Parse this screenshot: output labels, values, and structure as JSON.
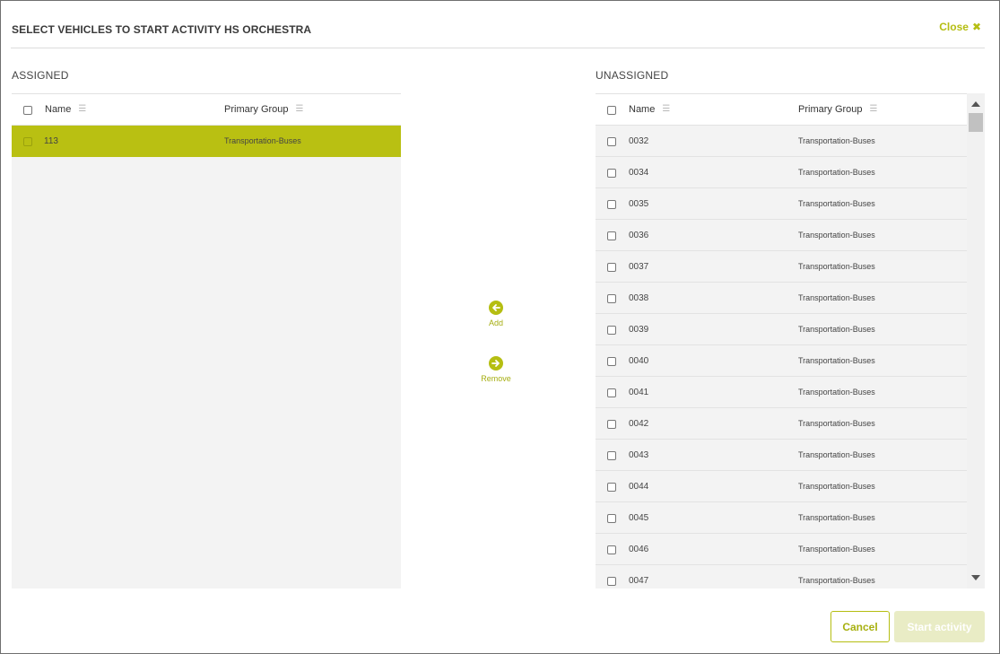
{
  "dialog": {
    "title": "SELECT VEHICLES TO START ACTIVITY HS ORCHESTRA",
    "close_label": "Close",
    "accent_color": "#b5be12"
  },
  "assigned": {
    "section_title": "ASSIGNED",
    "columns": {
      "name": "Name",
      "group": "Primary Group"
    },
    "rows": [
      {
        "name": "113",
        "group": "Transportation-Buses",
        "selected": true
      }
    ]
  },
  "unassigned": {
    "section_title": "UNASSIGNED",
    "columns": {
      "name": "Name",
      "group": "Primary Group"
    },
    "rows": [
      {
        "name": "0032",
        "group": "Transportation-Buses"
      },
      {
        "name": "0034",
        "group": "Transportation-Buses"
      },
      {
        "name": "0035",
        "group": "Transportation-Buses"
      },
      {
        "name": "0036",
        "group": "Transportation-Buses"
      },
      {
        "name": "0037",
        "group": "Transportation-Buses"
      },
      {
        "name": "0038",
        "group": "Transportation-Buses"
      },
      {
        "name": "0039",
        "group": "Transportation-Buses"
      },
      {
        "name": "0040",
        "group": "Transportation-Buses"
      },
      {
        "name": "0041",
        "group": "Transportation-Buses"
      },
      {
        "name": "0042",
        "group": "Transportation-Buses"
      },
      {
        "name": "0043",
        "group": "Transportation-Buses"
      },
      {
        "name": "0044",
        "group": "Transportation-Buses"
      },
      {
        "name": "0045",
        "group": "Transportation-Buses"
      },
      {
        "name": "0046",
        "group": "Transportation-Buses"
      },
      {
        "name": "0047",
        "group": "Transportation-Buses"
      }
    ]
  },
  "actions": {
    "add_label": "Add",
    "remove_label": "Remove"
  },
  "footer": {
    "cancel_label": "Cancel",
    "start_label": "Start activity"
  }
}
